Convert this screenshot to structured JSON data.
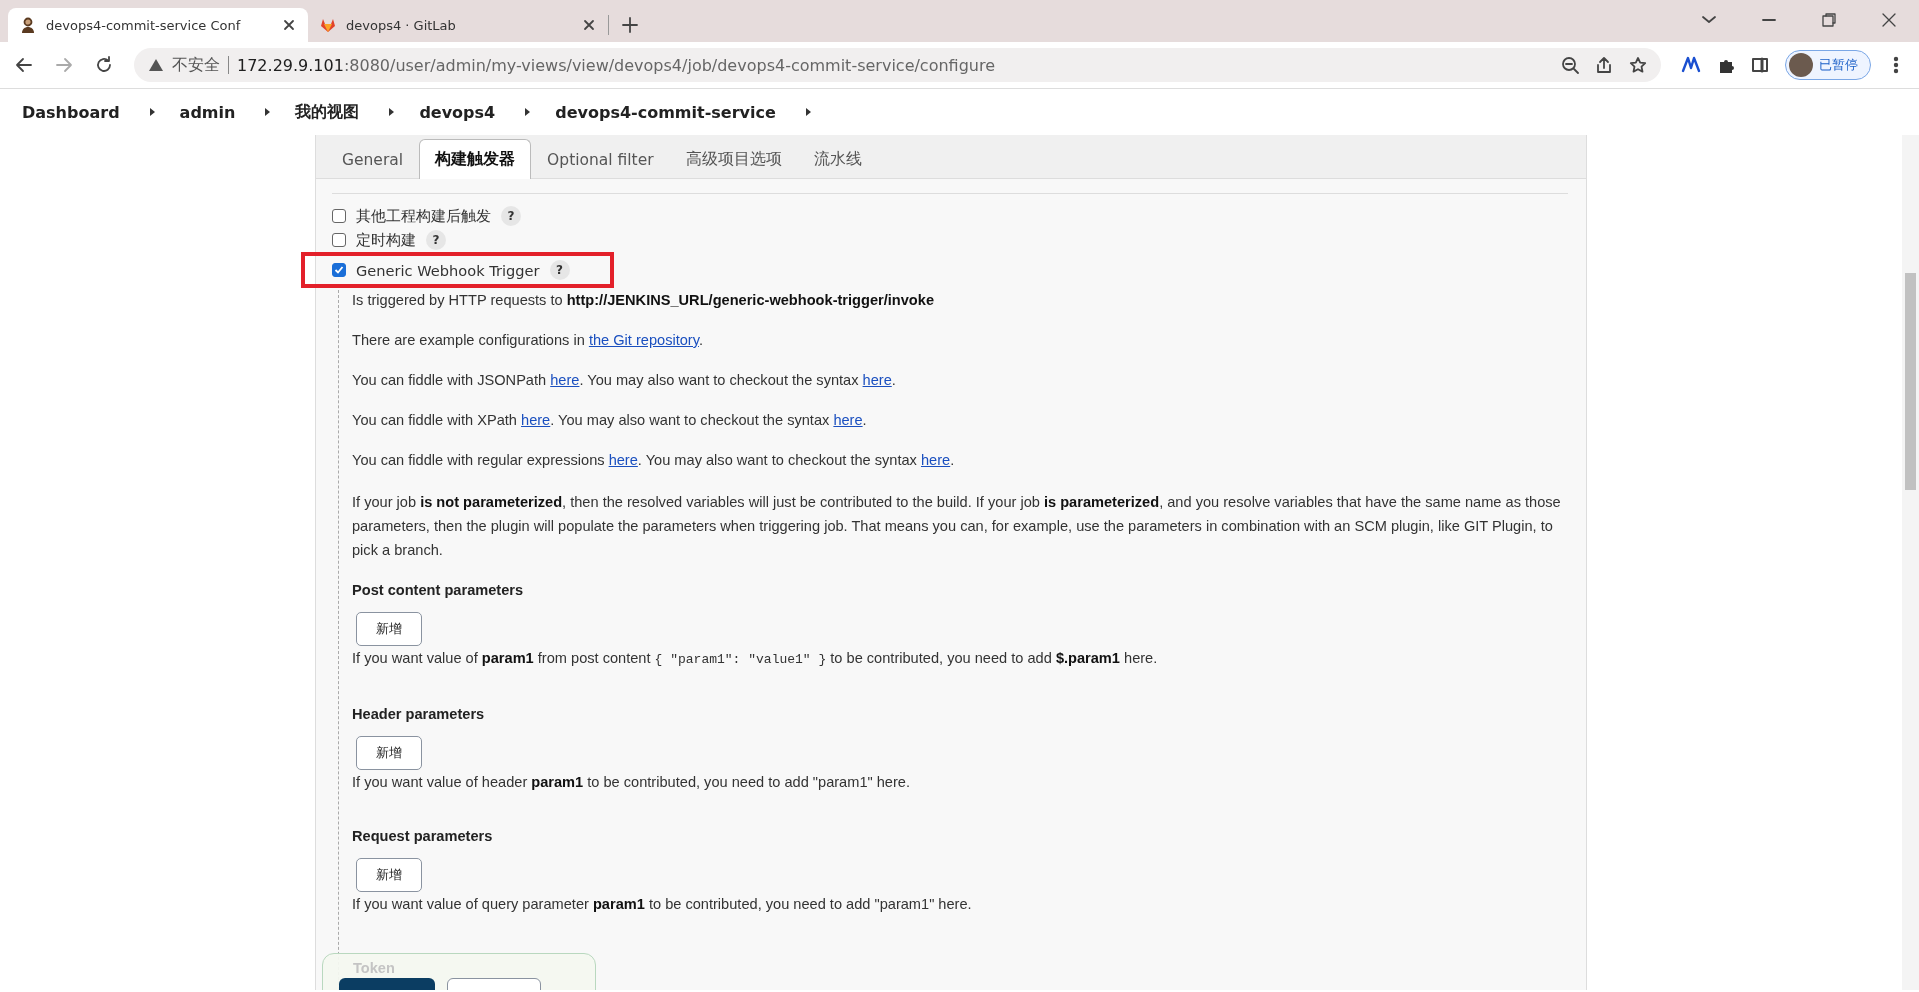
{
  "browser": {
    "tabs": [
      {
        "title": "devops4-commit-service Conf",
        "selected": true
      },
      {
        "title": "devops4 · GitLab",
        "selected": false
      }
    ],
    "address": {
      "security": "不安全",
      "host": "172.29.9.101",
      "path": ":8080/user/admin/my-views/view/devops4/job/devops4-commit-service/configure"
    },
    "profile": {
      "label": "已暂停"
    }
  },
  "breadcrumbs": [
    "Dashboard",
    "admin",
    "我的视图",
    "devops4",
    "devops4-commit-service"
  ],
  "config_tabs": [
    {
      "label": "General",
      "selected": false
    },
    {
      "label": "构建触发器",
      "selected": true
    },
    {
      "label": "Optional filter",
      "selected": false
    },
    {
      "label": "高级项目选项",
      "selected": false
    },
    {
      "label": "流水线",
      "selected": false
    }
  ],
  "triggers": [
    {
      "label": "其他工程构建后触发",
      "checked": false,
      "help": "?",
      "highlighted": false
    },
    {
      "label": "定时构建",
      "checked": false,
      "help": "?",
      "highlighted": false
    },
    {
      "label": "Generic Webhook Trigger",
      "checked": true,
      "help": "?",
      "highlighted": true
    }
  ],
  "description": [
    [
      {
        "kind": "text",
        "text": "Is triggered by HTTP requests to "
      },
      {
        "kind": "bold",
        "text": "http://JENKINS_URL/generic-webhook-trigger/invoke"
      }
    ],
    [
      {
        "kind": "text",
        "text": "There are example configurations in "
      },
      {
        "kind": "link",
        "text": "the Git repository"
      },
      {
        "kind": "text",
        "text": "."
      }
    ],
    [
      {
        "kind": "text",
        "text": "You can fiddle with JSONPath "
      },
      {
        "kind": "link",
        "text": "here"
      },
      {
        "kind": "text",
        "text": ". You may also want to checkout the syntax "
      },
      {
        "kind": "link",
        "text": "here"
      },
      {
        "kind": "text",
        "text": "."
      }
    ],
    [
      {
        "kind": "text",
        "text": "You can fiddle with XPath "
      },
      {
        "kind": "link",
        "text": "here"
      },
      {
        "kind": "text",
        "text": ". You may also want to checkout the syntax "
      },
      {
        "kind": "link",
        "text": "here"
      },
      {
        "kind": "text",
        "text": "."
      }
    ],
    [
      {
        "kind": "text",
        "text": "You can fiddle with regular expressions "
      },
      {
        "kind": "link",
        "text": "here"
      },
      {
        "kind": "text",
        "text": ". You may also want to checkout the syntax "
      },
      {
        "kind": "link",
        "text": "here"
      },
      {
        "kind": "text",
        "text": "."
      }
    ],
    [
      {
        "kind": "text",
        "text": "If your job "
      },
      {
        "kind": "bold",
        "text": "is not parameterized"
      },
      {
        "kind": "text",
        "text": ", then the resolved variables will just be contributed to the build. If your job "
      },
      {
        "kind": "bold",
        "text": "is parameterized"
      },
      {
        "kind": "text",
        "text": ", and you resolve variables that have the same name as those parameters, then the plugin will populate the parameters when triggering job. That means you can, for example, use the parameters in combination with an SCM plugin, like GIT Plugin, to pick a branch."
      }
    ]
  ],
  "parameter_sections": [
    {
      "title": "Post content parameters",
      "button": "新增",
      "note": [
        {
          "kind": "text",
          "text": "If you want value of "
        },
        {
          "kind": "bold",
          "text": "param1"
        },
        {
          "kind": "text",
          "text": " from post content "
        },
        {
          "kind": "code",
          "text": "{ \"param1\": \"value1\" }"
        },
        {
          "kind": "text",
          "text": " to be contributed, you need to add "
        },
        {
          "kind": "bold",
          "text": "$.param1"
        },
        {
          "kind": "text",
          "text": " here."
        }
      ]
    },
    {
      "title": "Header parameters",
      "button": "新增",
      "note": [
        {
          "kind": "text",
          "text": "If you want value of header "
        },
        {
          "kind": "bold",
          "text": "param1"
        },
        {
          "kind": "text",
          "text": " to be contributed, you need to add \"param1\" here."
        }
      ]
    },
    {
      "title": "Request parameters",
      "button": "新增",
      "note": [
        {
          "kind": "text",
          "text": "If you want value of query parameter "
        },
        {
          "kind": "bold",
          "text": "param1"
        },
        {
          "kind": "text",
          "text": " to be contributed, you need to add \"param1\" here."
        }
      ]
    }
  ],
  "token": {
    "label": "Token"
  }
}
